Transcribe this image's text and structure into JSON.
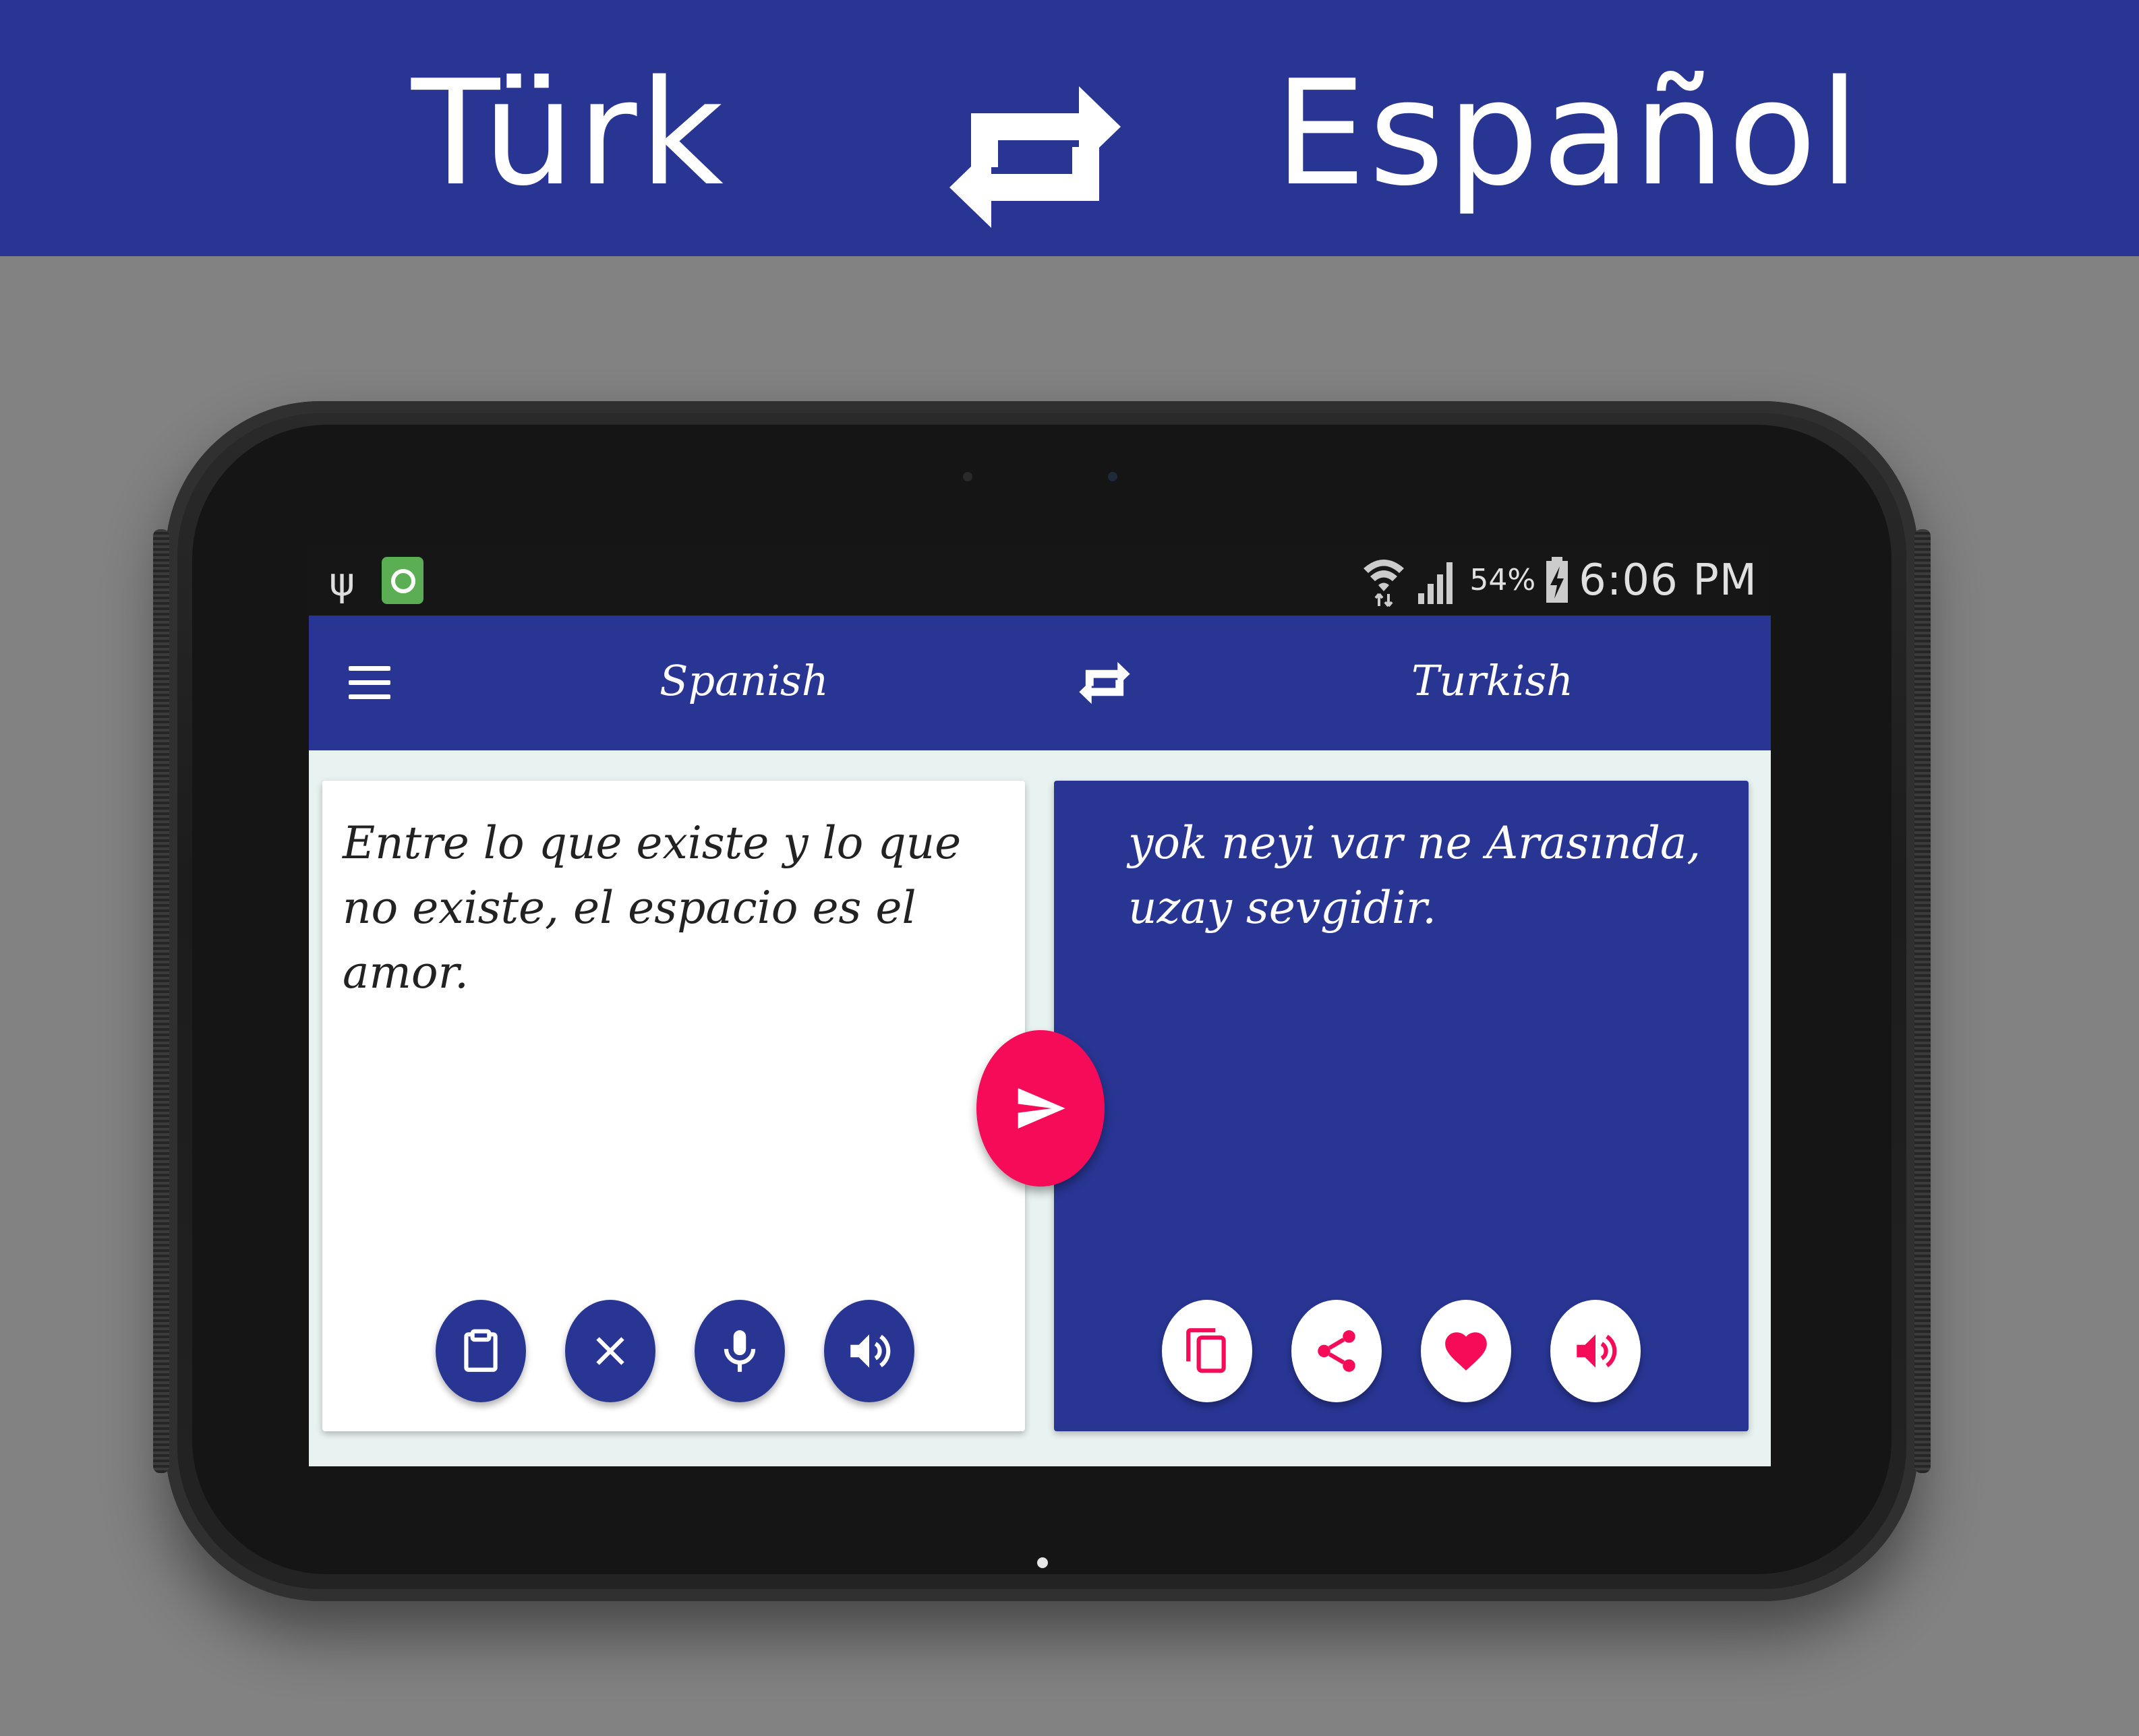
{
  "banner": {
    "left_language": "Türk",
    "right_language": "Español",
    "swap_icon": "swap-arrows-icon",
    "background": "#283593"
  },
  "status_bar": {
    "left_icons": [
      "usb-icon",
      "app-notification-icon"
    ],
    "wifi_icon": "wifi-icon",
    "signal_icon": "cell-signal-icon",
    "battery_percent": "54%",
    "battery_icon": "battery-charging-icon",
    "time": "6:06 PM"
  },
  "app_bar": {
    "menu_icon": "hamburger-menu-icon",
    "source_language": "Spanish",
    "swap_icon": "swap-arrows-icon",
    "target_language": "Turkish",
    "color": "#283593"
  },
  "source_panel": {
    "text": "Entre lo que existe y lo que no existe, el espacio es el amor.",
    "buttons": [
      {
        "name": "paste-button",
        "icon": "clipboard-icon"
      },
      {
        "name": "clear-button",
        "icon": "close-icon"
      },
      {
        "name": "microphone-button",
        "icon": "microphone-icon"
      },
      {
        "name": "speak-source-button",
        "icon": "speaker-icon"
      }
    ]
  },
  "translate_button": {
    "icon": "send-icon",
    "color": "#f50b57"
  },
  "target_panel": {
    "text": "yok neyi var ne Arasında, uzay sevgidir.",
    "buttons": [
      {
        "name": "copy-button",
        "icon": "copy-icon"
      },
      {
        "name": "share-button",
        "icon": "share-icon"
      },
      {
        "name": "favorite-button",
        "icon": "heart-icon"
      },
      {
        "name": "speak-target-button",
        "icon": "speaker-icon"
      }
    ]
  },
  "colors": {
    "primary": "#283593",
    "accent": "#f50b57",
    "background": "#828282"
  }
}
